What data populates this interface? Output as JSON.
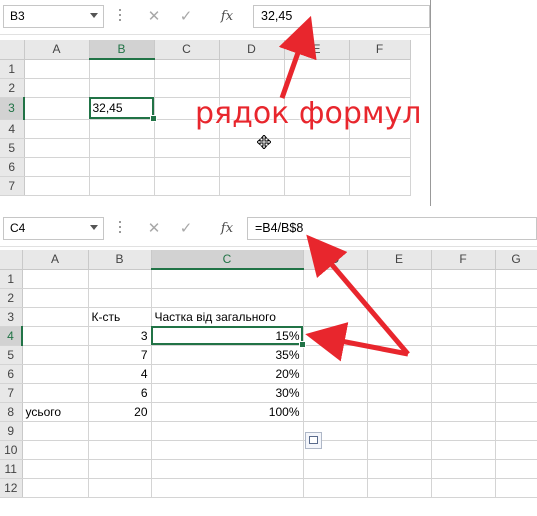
{
  "top": {
    "name_box": "B3",
    "formula": "32,45",
    "columns": [
      "A",
      "B",
      "C",
      "D",
      "E",
      "F"
    ],
    "rows": [
      "1",
      "2",
      "3",
      "4",
      "5",
      "6",
      "7"
    ],
    "cell_b3": "32,45"
  },
  "annotation": {
    "text": "рядок формул",
    "color": "#e8262d"
  },
  "bottom": {
    "name_box": "C4",
    "formula": "=B4/B$8",
    "columns": [
      "A",
      "B",
      "C",
      "D",
      "E",
      "F",
      "G"
    ],
    "rows": [
      "1",
      "2",
      "3",
      "4",
      "5",
      "6",
      "7",
      "8",
      "9",
      "10",
      "11",
      "12"
    ],
    "header_count": "К-сть",
    "header_share": "Частка від загального",
    "counts": [
      "3",
      "7",
      "4",
      "6"
    ],
    "shares": [
      "15%",
      "35%",
      "20%",
      "30%"
    ],
    "total_label": "усього",
    "total_count": "20",
    "total_share": "100%"
  },
  "icons": {
    "cancel": "✕",
    "enter": "✓",
    "insert_function": "fx",
    "paste_options": "paste-options-icon"
  },
  "colors": {
    "excel_green": "#217346",
    "arrow_red": "#e8262d"
  }
}
